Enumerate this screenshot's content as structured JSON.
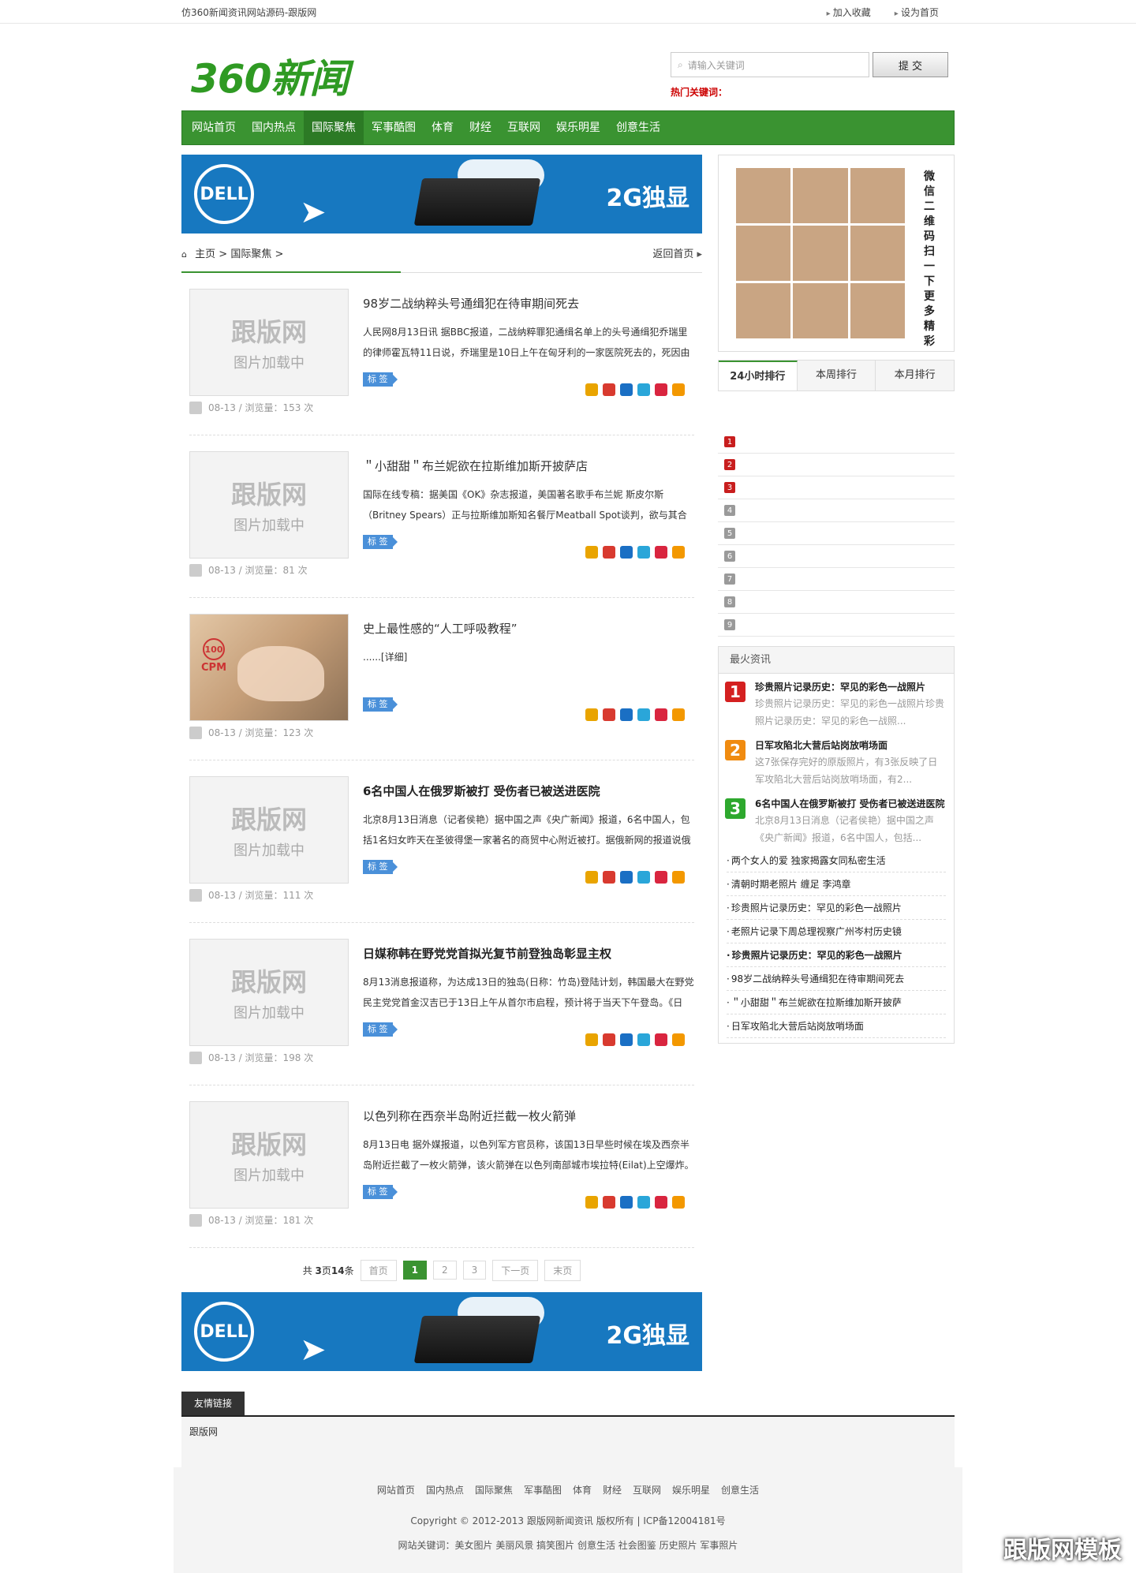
{
  "topbar": {
    "site_title": "仿360新闻资讯网站源码-跟版网",
    "bookmark": "加入收藏",
    "homepage": "设为首页"
  },
  "header": {
    "logo": "360新闻",
    "search_placeholder": "请输入关键词",
    "search_button": "提 交",
    "hot_keywords": "热门关键词："
  },
  "nav": [
    "网站首页",
    "国内热点",
    "国际聚焦",
    "军事酷图",
    "体育",
    "财经",
    "互联网",
    "娱乐明星",
    "创意生活"
  ],
  "ad": {
    "brand": "DELL",
    "slogan": "2G独显"
  },
  "breadcrumb": {
    "home": "主页",
    "sep": ">",
    "current": "国际聚焦",
    "back": "返回首页"
  },
  "thumb_placeholder": {
    "line1": "跟版网",
    "line2": "图片加载中"
  },
  "tag_label": "标 签",
  "articles": [
    {
      "title": "98岁二战纳粹头号通缉犯在待审期间死去",
      "desc": "人民网8月13日讯 据BBC报道，二战纳粹罪犯通缉名单上的头号通缉犯乔瑞里的律师霍瓦特11日说，乔瑞里是10日上午在匈牙利的一家医院死去的，死因由",
      "meta": "08-13 / 浏览量：153 次"
    },
    {
      "title": "＂小甜甜＂布兰妮欲在拉斯维加斯开披萨店",
      "desc": "国际在线专稿：据美国《OK》杂志报道，美国著名歌手布兰妮 斯皮尔斯（Britney Spears）正与拉斯维加斯知名餐厅Meatball Spot谈判，欲与其合作",
      "meta": "08-13 / 浏览量：81 次"
    },
    {
      "title": "史上最性感的“人工呼吸教程”",
      "desc": "......[详细]",
      "meta": "08-13 / 浏览量：123 次"
    },
    {
      "title": "6名中国人在俄罗斯被打 受伤者已被送进医院",
      "desc": "北京8月13日消息（记者侯艳）据中国之声《央广新闻》报道，6名中国人，包括1名妇女昨天在圣彼得堡一家著名的商贸中心附近被打。据俄新网的报道说俄",
      "meta": "08-13 / 浏览量：111 次"
    },
    {
      "title": "日媒称韩在野党党首拟光复节前登独岛彰显主权",
      "desc": "8月13消息报道称，为达成13日的独岛(日称：竹岛)登陆计划，韩国最大在野党民主党党首金汉吉已于13日上午从首尔市启程，预计将于当天下午登岛。《日",
      "meta": "08-13 / 浏览量：198 次"
    },
    {
      "title": "以色列称在西奈半岛附近拦截一枚火箭弹",
      "desc": "8月13日电 据外媒报道，以色列军方官员称，该国13日早些时候在埃及西奈半岛附近拦截了一枚火箭弹，该火箭弹在以色列南部城市埃拉特(Eilat)上空爆炸。",
      "meta": "08-13 / 浏览量：181 次"
    }
  ],
  "cpm": {
    "num": "100",
    "label": "CPM"
  },
  "pager": {
    "summary_prefix": "共",
    "pages": "3",
    "summary_mid": "页",
    "count": "14",
    "summary_suffix": "条",
    "first": "首页",
    "p1": "1",
    "p2": "2",
    "p3": "3",
    "next": "下一页",
    "last": "末页"
  },
  "qr_text": "微信二维码扫一下更多精彩",
  "rank_tabs": [
    "24小时排行",
    "本周排行",
    "本月排行"
  ],
  "rank_numbers": [
    "1",
    "2",
    "3",
    "4",
    "5",
    "6",
    "7",
    "8",
    "9"
  ],
  "hot": {
    "title": "最火资讯",
    "featured": [
      {
        "num": "1",
        "title": "珍贵照片记录历史：罕见的彩色一战照片",
        "desc": "珍贵照片记录历史：罕见的彩色一战照片珍贵照片记录历史：罕见的彩色一战照...",
        "color": "#d42020"
      },
      {
        "num": "2",
        "title": "日军攻陷北大营后站岗放哨场面",
        "desc": "这7张保存完好的原版照片，有3张反映了日军攻陷北大营后站岗放哨场面，有2...",
        "color": "#f08b10"
      },
      {
        "num": "3",
        "title": "6名中国人在俄罗斯被打 受伤者已被送进医院",
        "desc": "北京8月13日消息（记者侯艳）据中国之声《央广新闻》报道，6名中国人，包括...",
        "color": "#2ea82e"
      }
    ],
    "list": [
      "两个女人的爱 独家揭露女同私密生活",
      "清朝时期老照片 缠足 李鸿章",
      "珍贵照片记录历史：罕见的彩色一战照片",
      "老照片记录下周总理视察广州岑村历史镜",
      "珍贵照片记录历史：罕见的彩色一战照片",
      "98岁二战纳粹头号通缉犯在待审期间死去",
      "＂小甜甜＂布兰妮欲在拉斯维加斯开披萨",
      "日军攻陷北大营后站岗放哨场面"
    ]
  },
  "friend": {
    "title": "友情链接",
    "link": "跟版网"
  },
  "footer": {
    "nav": [
      "网站首页",
      "国内热点",
      "国际聚焦",
      "军事酷图",
      "体育",
      "财经",
      "互联网",
      "娱乐明星",
      "创意生活"
    ],
    "copyright": "Copyright © 2012-2013 跟版网新闻资讯 版权所有 | ICP备12004181号",
    "keywords": "网站关键词：美女图片 美丽风景 搞笑图片 创意生活 社会图鉴 历史照片 军事照片"
  },
  "watermark": "跟版网模板",
  "colors": {
    "brand_green": "#3a9331",
    "ad_blue": "#1778c0",
    "rank_red": "#c81e1e",
    "rank_gray": "#9a9a9a"
  }
}
